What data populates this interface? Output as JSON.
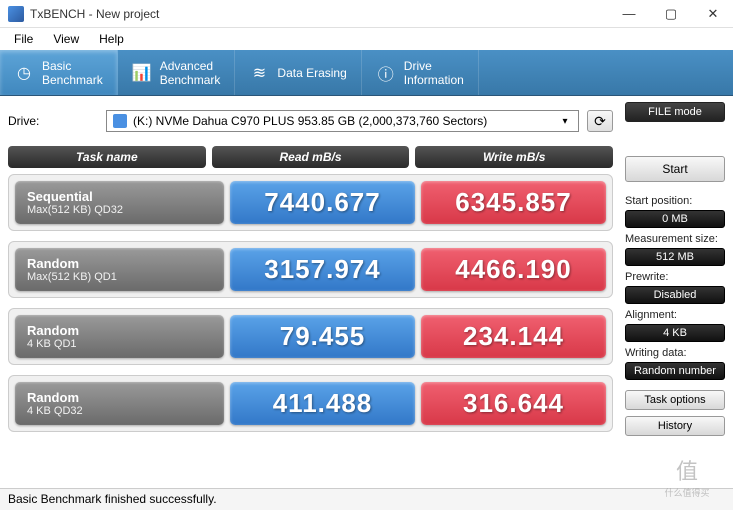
{
  "window": {
    "title": "TxBENCH - New project"
  },
  "menu": {
    "file": "File",
    "view": "View",
    "help": "Help"
  },
  "tabs": {
    "basic": "Basic\nBenchmark",
    "advanced": "Advanced\nBenchmark",
    "erasing": "Data Erasing",
    "drive_info": "Drive\nInformation"
  },
  "drive": {
    "label": "Drive:",
    "selected": "(K:) NVMe Dahua C970 PLUS  953.85 GB (2,000,373,760 Sectors)"
  },
  "file_mode_btn": "FILE mode",
  "headers": {
    "task": "Task name",
    "read": "Read mB/s",
    "write": "Write mB/s"
  },
  "rows": [
    {
      "title": "Sequential",
      "sub": "Max(512 KB) QD32",
      "read": "7440.677",
      "write": "6345.857"
    },
    {
      "title": "Random",
      "sub": "Max(512 KB) QD1",
      "read": "3157.974",
      "write": "4466.190"
    },
    {
      "title": "Random",
      "sub": "4 KB QD1",
      "read": "79.455",
      "write": "234.144"
    },
    {
      "title": "Random",
      "sub": "4 KB QD32",
      "read": "411.488",
      "write": "316.644"
    }
  ],
  "sidebar": {
    "start": "Start",
    "start_pos_label": "Start position:",
    "start_pos": "0 MB",
    "meas_label": "Measurement size:",
    "meas": "512 MB",
    "prewrite_label": "Prewrite:",
    "prewrite": "Disabled",
    "align_label": "Alignment:",
    "align": "4 KB",
    "writedata_label": "Writing data:",
    "writedata": "Random number",
    "task_options": "Task options",
    "history": "History"
  },
  "status": "Basic Benchmark finished successfully.",
  "watermark": {
    "top": "值",
    "bottom": "什么值得买"
  }
}
